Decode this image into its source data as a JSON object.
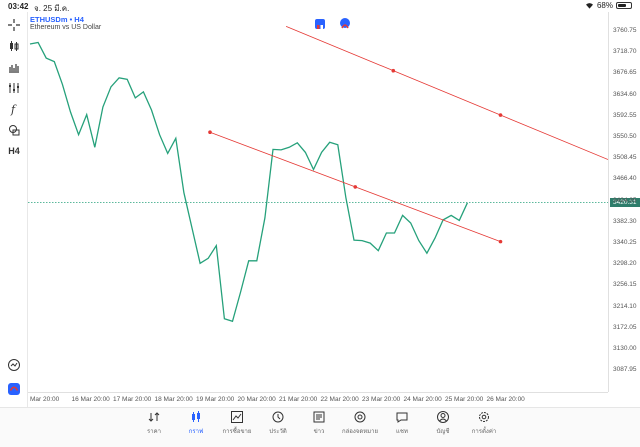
{
  "status": {
    "time": "03:42",
    "date": "จ. 25 มี.ค.",
    "battery": "68%",
    "battery_level": 0.68
  },
  "symbol": {
    "name": "ETHUSDm • H4",
    "description": "Ethereum vs US Dollar"
  },
  "price_axis": [
    "3760.75",
    "3718.70",
    "3676.65",
    "3634.60",
    "3592.55",
    "3550.50",
    "3508.45",
    "3466.40",
    "3424.35",
    "3382.30",
    "3340.25",
    "3298.20",
    "3256.15",
    "3214.10",
    "3172.05",
    "3130.00",
    "3087.95"
  ],
  "current_price": "3420.31",
  "time_axis": [
    "Mar 20:00",
    "16 Mar 20:00",
    "17 Mar 20:00",
    "18 Mar 20:00",
    "19 Mar 20:00",
    "20 Mar 20:00",
    "21 Mar 20:00",
    "22 Mar 20:00",
    "23 Mar 20:00",
    "24 Mar 20:00",
    "25 Mar 20:00",
    "26 Mar 20:00"
  ],
  "toolbar": [
    "crosshair-icon",
    "candles-icon",
    "bars-icon",
    "indicators-icon",
    "function-icon",
    "objects-icon",
    "timeframe"
  ],
  "timeframe": "H4",
  "chart_data": {
    "type": "line",
    "series": [
      {
        "values": [
          3735,
          3738,
          3707,
          3700,
          3655,
          3600,
          3555,
          3595,
          3530,
          3610,
          3650,
          3668,
          3665,
          3628,
          3640,
          3604,
          3555,
          3518,
          3548,
          3440,
          3370,
          3300,
          3310,
          3335,
          3190,
          3185,
          3243,
          3305,
          3305,
          3390,
          3526,
          3525,
          3530,
          3539,
          3520,
          3486,
          3520,
          3540,
          3535,
          3430,
          3346,
          3345,
          3340,
          3325,
          3360,
          3360,
          3395,
          3380,
          3345,
          3320,
          3350,
          3386,
          3395,
          3385,
          3420
        ]
      }
    ],
    "trendlines": [
      {
        "from": [
          "19 Mar 20:00",
          3560
        ],
        "to": [
          "26 Mar 20:00",
          3343
        ]
      },
      {
        "from": [
          "21 Mar 16:00",
          3770
        ],
        "to": [
          "26 Mar 20:00",
          3594
        ]
      }
    ],
    "line_color": "#26a17b",
    "trendline_color": "#e53935"
  },
  "bottom_nav": [
    {
      "label": "ราคา",
      "icon": "quotes-icon"
    },
    {
      "label": "กราฟ",
      "icon": "chart-icon",
      "active": true
    },
    {
      "label": "การซื้อขาย",
      "icon": "trade-icon"
    },
    {
      "label": "ประวัติ",
      "icon": "history-icon"
    },
    {
      "label": "ข่าว",
      "icon": "news-icon"
    },
    {
      "label": "กล่องจดหมาย",
      "icon": "mail-icon"
    },
    {
      "label": "แชท",
      "icon": "chat-icon"
    },
    {
      "label": "บัญชี",
      "icon": "account-icon"
    },
    {
      "label": "การตั้งค่า",
      "icon": "settings-icon"
    }
  ]
}
